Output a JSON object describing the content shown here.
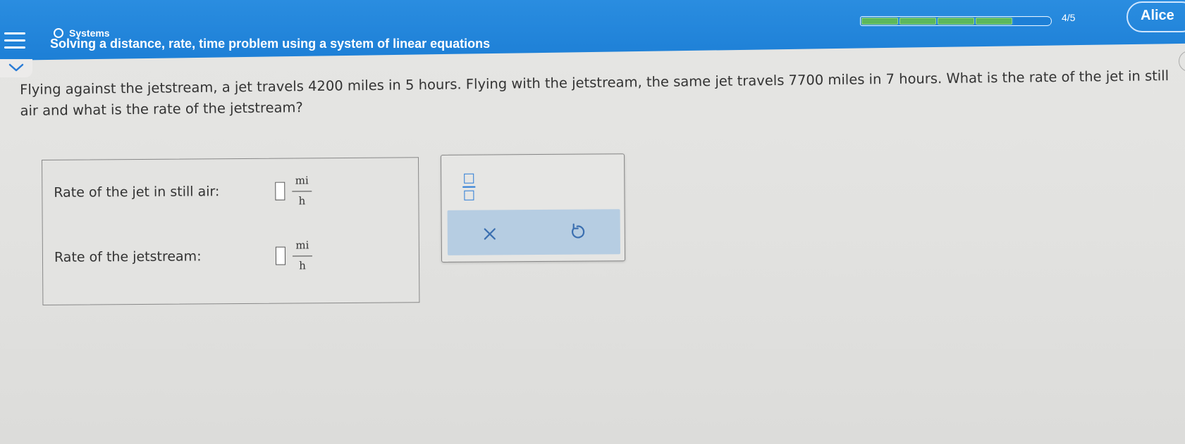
{
  "header": {
    "topic": "Systems",
    "title": "Solving a distance, rate, time problem using a system of linear equations",
    "progress": {
      "completed": 4,
      "total": 5,
      "text": "4/5"
    },
    "user_name": "Alice",
    "colors": {
      "bar": "#1d7fd6",
      "progress_fill": "#5cb85c",
      "progress_empty": "#1d7fd6"
    }
  },
  "icons": {
    "menu": "hamburger-icon",
    "topic": "circle-icon",
    "collapse": "chevron-down-icon",
    "fraction": "fraction-template-icon",
    "clear": "x-icon",
    "undo": "undo-icon"
  },
  "problem": {
    "text": "Flying against the jetstream, a jet travels 4200 miles in 5 hours. Flying with the jetstream, the same jet travels 7700 miles in 7 hours. What is the rate of the jet in still air and what is the rate of the jetstream?"
  },
  "answers": [
    {
      "label": "Rate of the jet in still air:",
      "value": "",
      "unit_numerator": "mi",
      "unit_denominator": "h"
    },
    {
      "label": "Rate of the jetstream:",
      "value": "",
      "unit_numerator": "mi",
      "unit_denominator": "h"
    }
  ],
  "toolbar": {
    "clear_symbol": "×"
  }
}
